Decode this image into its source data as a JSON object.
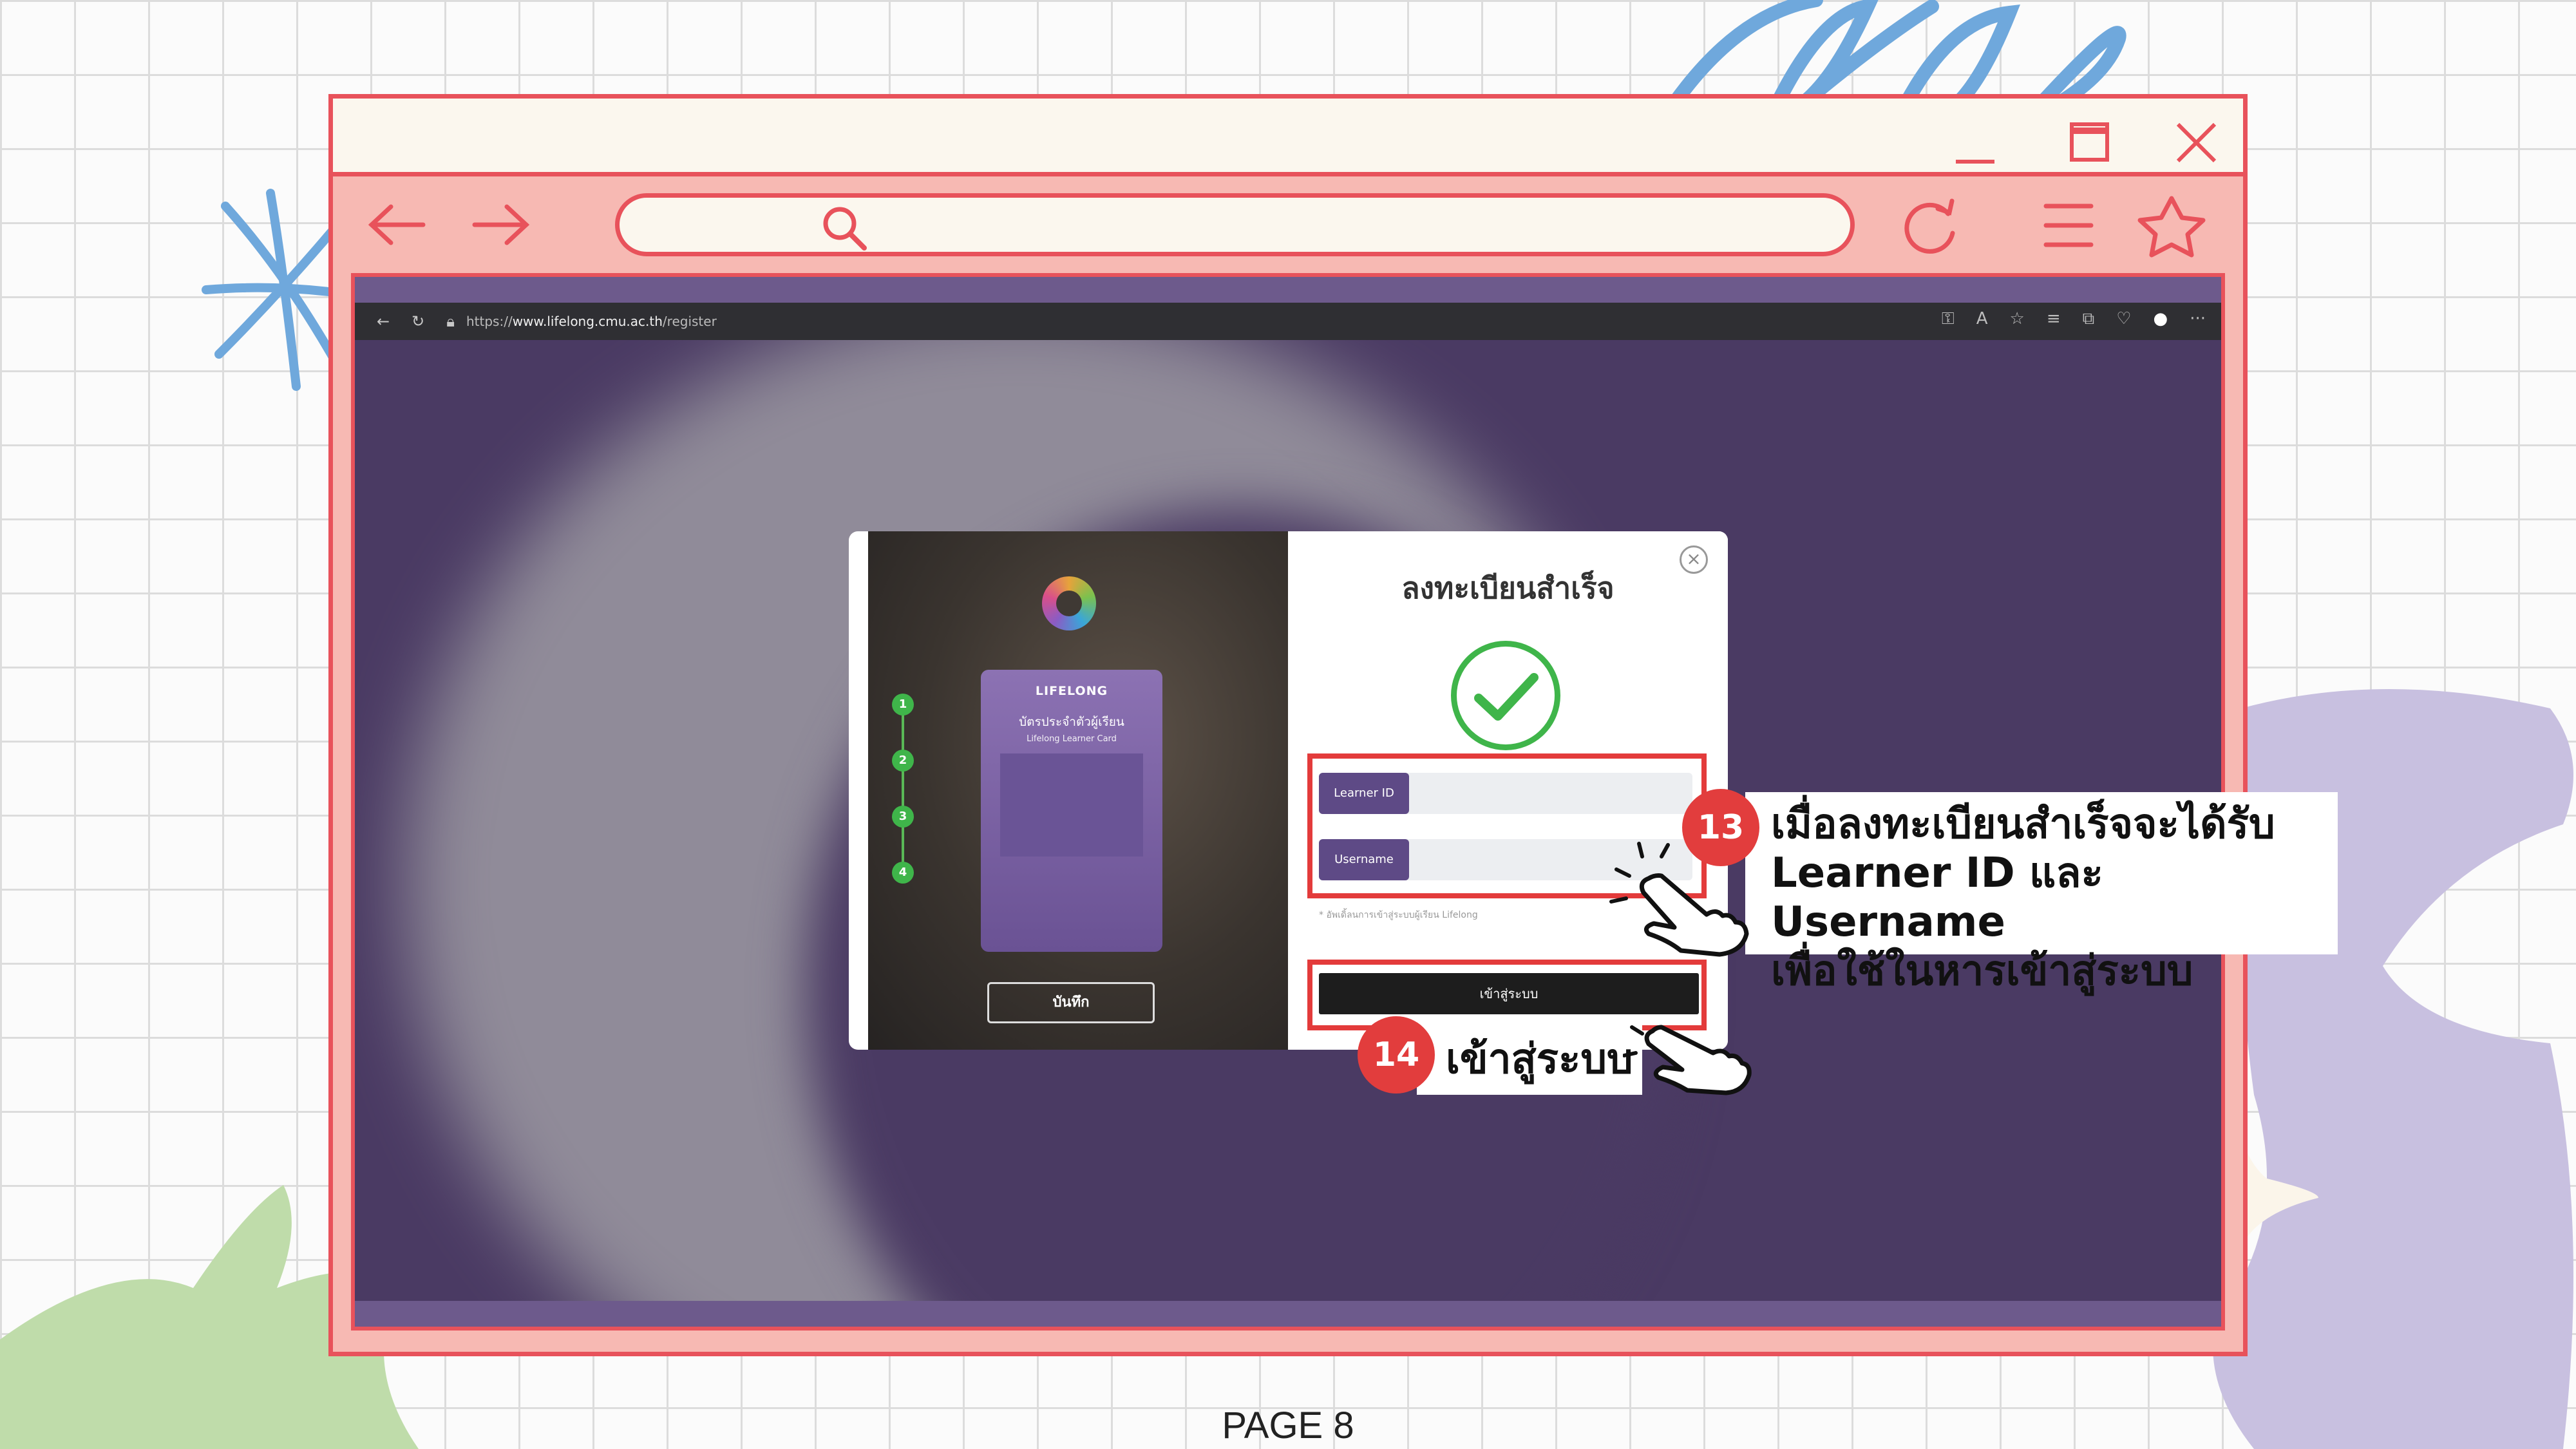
{
  "browser": {
    "url_scheme": "https://",
    "url_host": "www.lifelong.cmu.ac.th",
    "url_path": "/register"
  },
  "modal": {
    "title": "ลงทะเบียนสำเร็จ",
    "close_label": "×",
    "steps": [
      "1",
      "2",
      "3",
      "4"
    ],
    "card_logo": "LIFELONG",
    "card_title": "บัตรประจำตัวผู้เรียน",
    "card_subtitle": "Lifelong Learner Card",
    "save_label": "บันทึก",
    "learner_id_label": "Learner ID",
    "username_label": "Username",
    "hint": "* อัพเดิ้ลนการเข้าสู่ระบบผู้เรียน Lifelong",
    "login_label": "เข้าสู่ระบบ"
  },
  "callouts": {
    "step13_number": "13",
    "step13_line1": "เมื่อลงทะเบียนสำเร็จจะได้รับ",
    "step13_line2": "Learner ID และ Username",
    "step13_line3": "เพื่อใช้ในหารเข้าสู่ระบบ",
    "step14_number": "14",
    "step14_text": "เข้าสู่ระบบ"
  },
  "page_label": "PAGE 8",
  "colors": {
    "frame_red": "#e8525b",
    "frame_pink": "#f7b9b3",
    "bg_purple": "#4a3a63",
    "accent_green": "#3fb54a",
    "badge_red": "#e23d3d"
  }
}
